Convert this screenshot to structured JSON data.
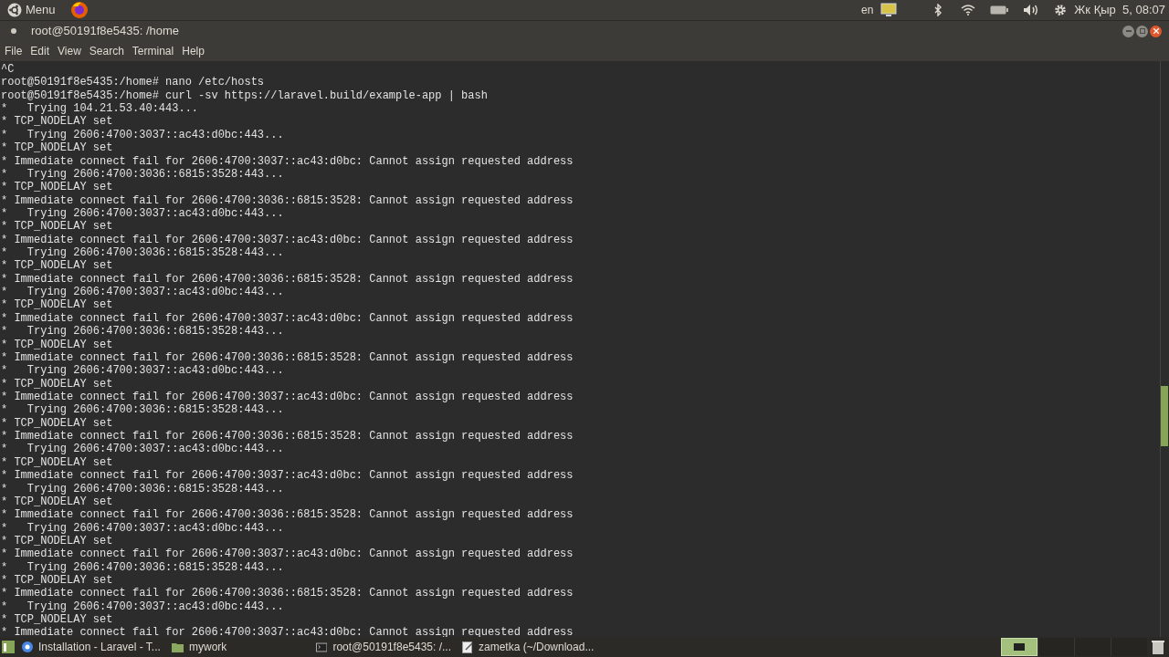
{
  "top_panel": {
    "menu_label": "Menu",
    "keyboard_layout": "en",
    "clock": "Жк Қыр  5, 08:07"
  },
  "window": {
    "title": "root@50191f8e5435: /home"
  },
  "menu_bar": [
    "File",
    "Edit",
    "View",
    "Search",
    "Terminal",
    "Help"
  ],
  "terminal_lines": [
    "^C",
    "root@50191f8e5435:/home# nano /etc/hosts",
    "root@50191f8e5435:/home# curl -sv https://laravel.build/example-app | bash",
    "*   Trying 104.21.53.40:443...",
    "* TCP_NODELAY set",
    "*   Trying 2606:4700:3037::ac43:d0bc:443...",
    "* TCP_NODELAY set",
    "* Immediate connect fail for 2606:4700:3037::ac43:d0bc: Cannot assign requested address",
    "*   Trying 2606:4700:3036::6815:3528:443...",
    "* TCP_NODELAY set",
    "* Immediate connect fail for 2606:4700:3036::6815:3528: Cannot assign requested address",
    "*   Trying 2606:4700:3037::ac43:d0bc:443...",
    "* TCP_NODELAY set",
    "* Immediate connect fail for 2606:4700:3037::ac43:d0bc: Cannot assign requested address",
    "*   Trying 2606:4700:3036::6815:3528:443...",
    "* TCP_NODELAY set",
    "* Immediate connect fail for 2606:4700:3036::6815:3528: Cannot assign requested address",
    "*   Trying 2606:4700:3037::ac43:d0bc:443...",
    "* TCP_NODELAY set",
    "* Immediate connect fail for 2606:4700:3037::ac43:d0bc: Cannot assign requested address",
    "*   Trying 2606:4700:3036::6815:3528:443...",
    "* TCP_NODELAY set",
    "* Immediate connect fail for 2606:4700:3036::6815:3528: Cannot assign requested address",
    "*   Trying 2606:4700:3037::ac43:d0bc:443...",
    "* TCP_NODELAY set",
    "* Immediate connect fail for 2606:4700:3037::ac43:d0bc: Cannot assign requested address",
    "*   Trying 2606:4700:3036::6815:3528:443...",
    "* TCP_NODELAY set",
    "* Immediate connect fail for 2606:4700:3036::6815:3528: Cannot assign requested address",
    "*   Trying 2606:4700:3037::ac43:d0bc:443...",
    "* TCP_NODELAY set",
    "* Immediate connect fail for 2606:4700:3037::ac43:d0bc: Cannot assign requested address",
    "*   Trying 2606:4700:3036::6815:3528:443...",
    "* TCP_NODELAY set",
    "* Immediate connect fail for 2606:4700:3036::6815:3528: Cannot assign requested address",
    "*   Trying 2606:4700:3037::ac43:d0bc:443...",
    "* TCP_NODELAY set",
    "* Immediate connect fail for 2606:4700:3037::ac43:d0bc: Cannot assign requested address",
    "*   Trying 2606:4700:3036::6815:3528:443...",
    "* TCP_NODELAY set",
    "* Immediate connect fail for 2606:4700:3036::6815:3528: Cannot assign requested address",
    "*   Trying 2606:4700:3037::ac43:d0bc:443...",
    "* TCP_NODELAY set",
    "* Immediate connect fail for 2606:4700:3037::ac43:d0bc: Cannot assign requested address"
  ],
  "taskbar": {
    "items": [
      {
        "kind": "browser",
        "label": "Installation - Laravel - T..."
      },
      {
        "kind": "folder",
        "label": "mywork"
      },
      {
        "kind": "terminal",
        "label": "root@50191f8e5435: /..."
      },
      {
        "kind": "editor",
        "label": "zametka (~/Download..."
      }
    ],
    "workspaces": [
      {
        "selected": true
      },
      {
        "selected": false
      },
      {
        "selected": false
      },
      {
        "selected": false
      }
    ]
  }
}
